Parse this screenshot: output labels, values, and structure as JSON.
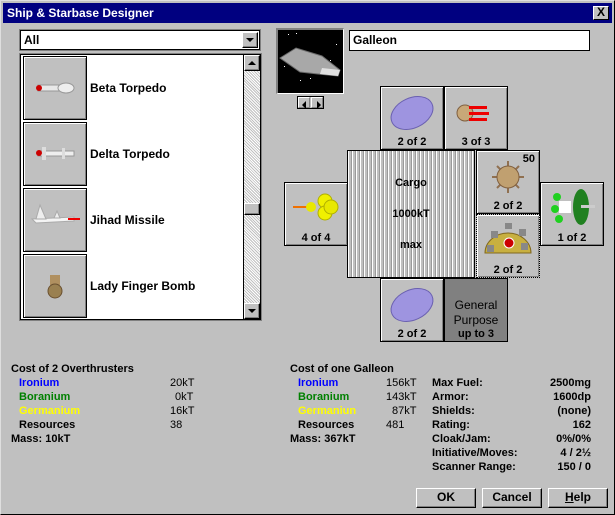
{
  "window": {
    "title": "Ship & Starbase Designer",
    "close_label": "X"
  },
  "filter": {
    "selected": "All"
  },
  "component_list": {
    "items": [
      {
        "label": "Beta Torpedo",
        "icon": "torpedo-icon"
      },
      {
        "label": "Delta Torpedo",
        "icon": "torpedo-icon"
      },
      {
        "label": "Jihad Missile",
        "icon": "missile-icon"
      },
      {
        "label": "Lady Finger Bomb",
        "icon": "bomb-icon"
      }
    ],
    "scroll_position": 0.6
  },
  "design": {
    "name": "Galleon",
    "hull_image": "galleon-hull-icon"
  },
  "slots": {
    "top_left": {
      "count": "2 of 2",
      "icon": "armor-plate-icon"
    },
    "top_right": {
      "count": "3 of 3",
      "icon": "overthruster-icon"
    },
    "left": {
      "count": "4 of 4",
      "icon": "engine-icon"
    },
    "right_upper": {
      "count": "2 of 2",
      "top_number": "50",
      "icon": "mine-icon"
    },
    "right_lower": {
      "count": "2 of 2",
      "icon": "shield-dome-icon"
    },
    "far_right": {
      "count": "1 of 2",
      "icon": "scanner-dish-icon"
    },
    "bottom_left": {
      "count": "2 of 2",
      "icon": "armor-plate-icon"
    },
    "cargo": {
      "line1": "Cargo",
      "line2": "1000kT",
      "line3": "max"
    },
    "general": {
      "line1": "General",
      "line2": "Purpose",
      "line3": "up to 3"
    }
  },
  "component_cost": {
    "title": "Cost of 2 Overthrusters",
    "ironium_label": "Ironium",
    "ironium": "20kT",
    "boranium_label": "Boranium",
    "boranium": "0kT",
    "germanium_label": "Germanium",
    "germanium": "16kT",
    "resources_label": "Resources",
    "resources": "38",
    "mass": "Mass: 10kT"
  },
  "ship_cost": {
    "title": "Cost of one Galleon",
    "ironium_label": "Ironium",
    "ironium": "156kT",
    "boranium_label": "Boranium",
    "boranium": "143kT",
    "germanium_label": "Germaniun",
    "germanium": "87kT",
    "resources_label": "Resources",
    "resources": "481",
    "mass": "Mass: 367kT"
  },
  "stats": [
    {
      "label": "Max Fuel:",
      "value": "2500mg"
    },
    {
      "label": "Armor:",
      "value": "1600dp"
    },
    {
      "label": "Shields:",
      "value": "(none)"
    },
    {
      "label": "Rating:",
      "value": "162"
    },
    {
      "label": "Cloak/Jam:",
      "value": "0%/0%"
    },
    {
      "label": "Initiative/Moves:",
      "value": "4 / 2½"
    },
    {
      "label": "Scanner Range:",
      "value": "150 / 0"
    }
  ],
  "buttons": {
    "ok": "OK",
    "cancel": "Cancel",
    "help_prefix": "H",
    "help_rest": "elp"
  },
  "colors": {
    "titlebar": "#000080",
    "ironium": "#0000ff",
    "boranium": "#008000",
    "germanium": "#ffff00"
  }
}
